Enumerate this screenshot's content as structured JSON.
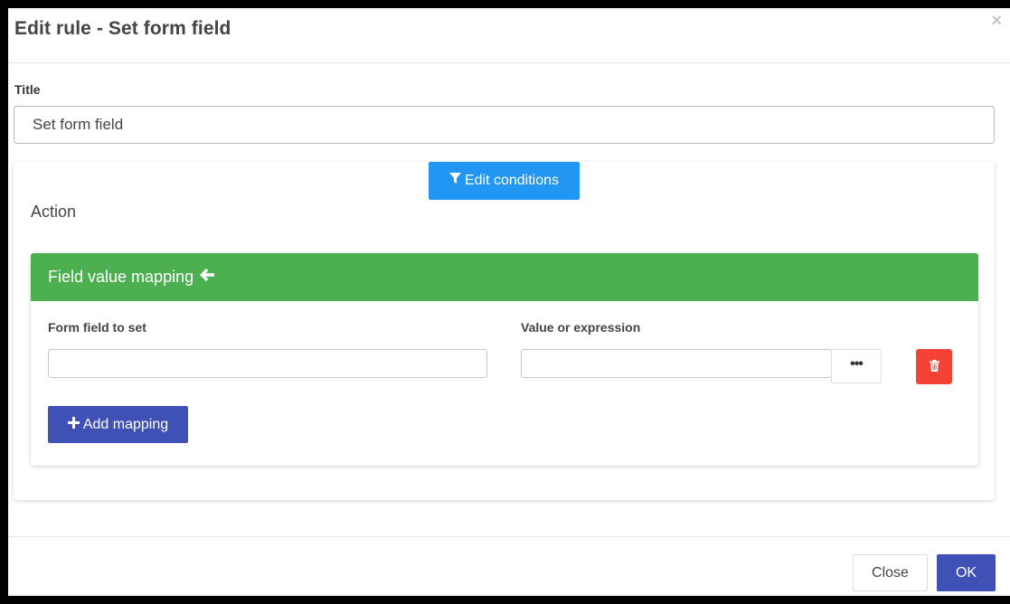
{
  "dialog": {
    "title": "Edit rule - Set form field",
    "close_glyph": "×"
  },
  "title_field": {
    "label": "Title",
    "value": "Set form field"
  },
  "conditions": {
    "button_label": "Edit conditions",
    "icon": "filter-icon"
  },
  "action": {
    "label": "Action"
  },
  "mapping": {
    "header": "Field value mapping",
    "header_icon": "arrow-left-icon",
    "header_color": "#4caf50",
    "columns": {
      "form_field_label": "Form field to set",
      "value_label": "Value or expression"
    },
    "row": {
      "form_field_value": "",
      "value_value": "",
      "ellipsis_label": "•••"
    },
    "add_button_label": "Add mapping",
    "add_icon": "plus-icon"
  },
  "footer": {
    "close_label": "Close",
    "ok_label": "OK"
  },
  "colors": {
    "primary": "#3f51b5",
    "info": "#2196f3",
    "success": "#4caf50",
    "danger": "#f44336"
  }
}
